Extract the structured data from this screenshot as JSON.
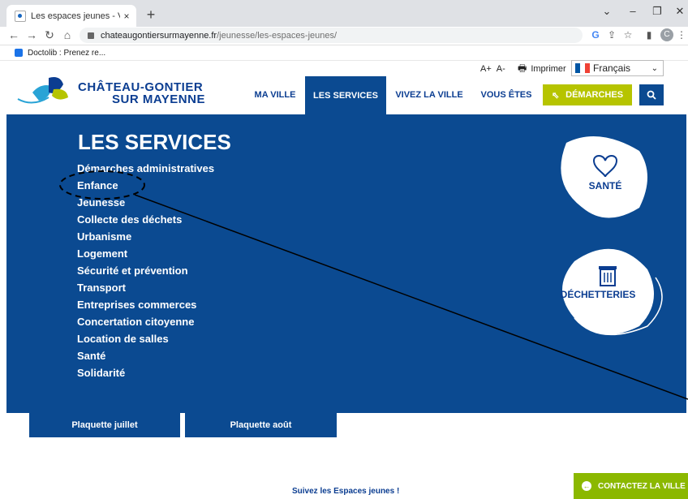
{
  "browser": {
    "tab_title": "Les espaces jeunes - Ville de Châ",
    "tab_close": "×",
    "new_tab": "+",
    "url_domain": "chateaugontiersurmayenne.fr",
    "url_path": "/jeunesse/les-espaces-jeunes/",
    "bookmark": "Doctolib : Prenez re...",
    "profile_initial": "C"
  },
  "header": {
    "font_up": "A+",
    "font_down": "A-",
    "print_label": "Imprimer",
    "language": "Français",
    "logo_line1": "CHÂTEAU-GONTIER",
    "logo_line2": "SUR MAYENNE",
    "menu": {
      "ma_ville": "MA VILLE",
      "les_services": "LES SERVICES",
      "vivez_la_ville": "VIVEZ LA VILLE",
      "vous_etes": "VOUS ÊTES"
    },
    "demarches": "DÉMARCHES"
  },
  "panel": {
    "title": "LES SERVICES",
    "services": [
      "Démarches administratives",
      "Enfance",
      "Jeunesse",
      "Collecte des déchets",
      "Urbanisme",
      "Logement",
      "Sécurité et prévention",
      "Transport",
      "Entreprises commerces",
      "Concertation citoyenne",
      "Location de salles",
      "Santé",
      "Solidarité"
    ],
    "card_sante": "SANTÉ",
    "card_dechetteries": "DÉCHETTERIES"
  },
  "footer": {
    "plaquette_juillet": "Plaquette juillet",
    "plaquette_aout": "Plaquette août",
    "suivez": "Suivez les Espaces jeunes !",
    "contact": "CONTACTEZ LA VILLE"
  },
  "colors": {
    "brand_blue": "#0b4a91",
    "accent_green": "#b6c400",
    "contact_green": "#8bb800"
  }
}
